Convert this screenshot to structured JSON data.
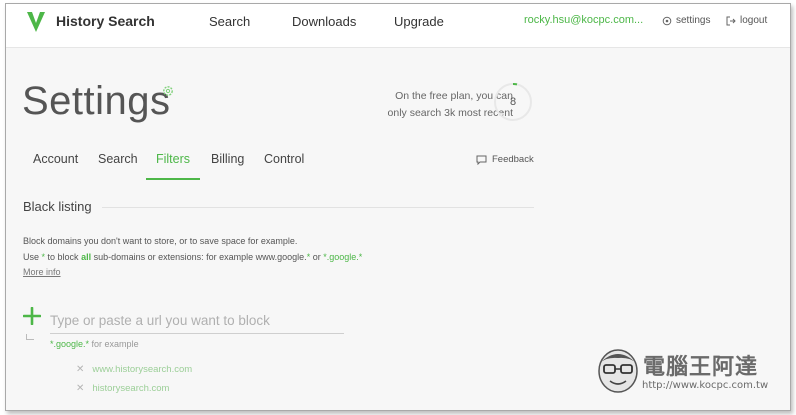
{
  "header": {
    "brand": "History Search",
    "nav": [
      "Search",
      "Downloads",
      "Upgrade"
    ],
    "user_email": "rocky.hsu@kocpc.com...",
    "settings_label": "settings",
    "logout_label": "logout"
  },
  "page": {
    "title": "Settings",
    "plan_line1": "On the free plan, you can",
    "plan_line2": "only search 3k most recent",
    "plan_count": "8"
  },
  "tabs": [
    "Account",
    "Search",
    "Filters",
    "Billing",
    "Control"
  ],
  "active_tab": "Filters",
  "feedback_label": "Feedback",
  "blacklist": {
    "title": "Black listing",
    "desc_line1": "Block domains you don't want to store, or to save space for example.",
    "desc2_pre": "Use ",
    "desc2_star": "*",
    "desc2_mid": " to block ",
    "desc2_all": "all",
    "desc2_post": " sub-domains or extensions: for example www.google.",
    "desc2_ex1": "*",
    "desc2_or": " or ",
    "desc2_ex2": "*.google.*",
    "more_info": "More info",
    "input_placeholder": "Type or paste a url you want to block",
    "input_value": "",
    "hint_example": "*.google.*",
    "hint_suffix": " for example",
    "items": [
      "www.historysearch.com",
      "historysearch.com"
    ]
  },
  "watermark": {
    "title": "電腦王阿達",
    "url": "http://www.kocpc.com.tw"
  },
  "colors": {
    "accent": "#4db748",
    "text": "#444444",
    "background": "#f7f7f7"
  },
  "icons": {
    "logo": "history-search-v-logo",
    "gear": "gear-icon",
    "logout": "logout-icon",
    "feedback": "chat-bubble-icon",
    "plus": "plus-icon",
    "remove": "close-icon"
  }
}
